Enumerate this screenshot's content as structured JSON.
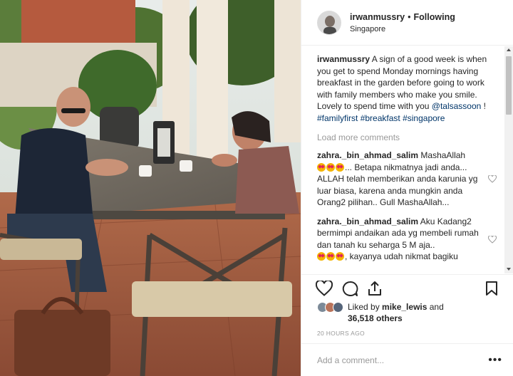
{
  "post": {
    "username": "irwanmussry",
    "separator": "•",
    "follow_status": "Following",
    "location": "Singapore"
  },
  "caption": {
    "username": "irwanmussry",
    "text_1": " A sign of a good week is when you get to spend Monday mornings having breakfast in the garden before going to work with family members who make you smile. Lovely to spend time with you ",
    "mention": "@talsassoon",
    "text_2": " ! ",
    "hashtags": [
      "#familyfirst",
      "#breakfast",
      "#singapore"
    ]
  },
  "load_more": "Load more comments",
  "comments": [
    {
      "username": "zahra._bin_ahmad_salim",
      "text_before": " MashaAllah",
      "text_after": "... Betapa nikmatnya jadi anda... ALLAH telah memberikan anda karunia yg luar biasa, karena anda mungkin anda Orang2 pilihan.. Gull MashaAllah..."
    },
    {
      "username": "zahra._bin_ahmad_salim",
      "text_before": " Aku Kadang2 bermimpi andaikan ada yg membeli rumah dan tanah ku seharga 5 M aja..",
      "text_after": ", kayanya udah nikmat bagiku"
    }
  ],
  "actions": {
    "like_icon": "heart-icon",
    "comment_icon": "comment-icon",
    "share_icon": "share-icon",
    "save_icon": "bookmark-icon"
  },
  "likes": {
    "prefix": "Liked by ",
    "first_user": "mike_lewis",
    "middle": " and",
    "count": "36,518 others"
  },
  "timestamp": "20 HOURS AGO",
  "add_comment": {
    "placeholder": "Add a comment...",
    "more_label": "•••"
  },
  "colors": {
    "link": "#003569",
    "muted": "#999999",
    "text": "#262626",
    "border": "#efefef"
  }
}
